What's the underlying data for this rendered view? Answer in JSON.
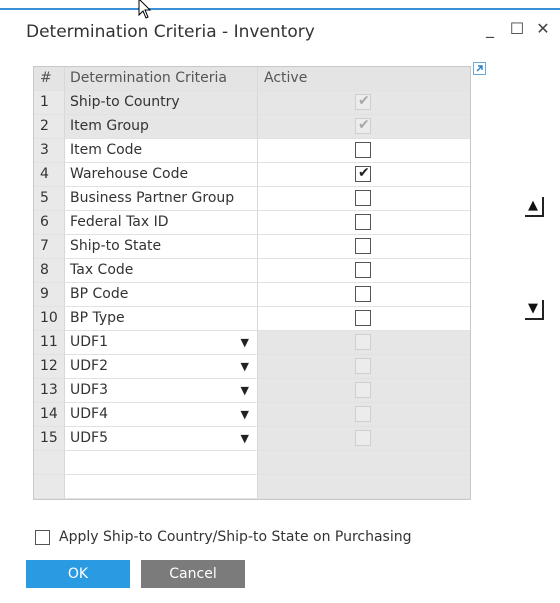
{
  "window": {
    "title": "Determination Criteria - Inventory",
    "minimize": "_",
    "maximize": "☐",
    "close": "✕"
  },
  "table": {
    "headers": [
      "#",
      "Determination Criteria",
      "Active"
    ],
    "rows": [
      {
        "num": "1",
        "criteria": "Ship-to Country",
        "active": true,
        "enabled": false,
        "dropdown": false,
        "gray": true
      },
      {
        "num": "2",
        "criteria": "Item Group",
        "active": true,
        "enabled": false,
        "dropdown": false,
        "gray": true
      },
      {
        "num": "3",
        "criteria": "Item Code",
        "active": false,
        "enabled": true,
        "dropdown": false,
        "gray": false
      },
      {
        "num": "4",
        "criteria": "Warehouse Code",
        "active": true,
        "enabled": true,
        "dropdown": false,
        "gray": false
      },
      {
        "num": "5",
        "criteria": "Business Partner Group",
        "active": false,
        "enabled": true,
        "dropdown": false,
        "gray": false
      },
      {
        "num": "6",
        "criteria": "Federal Tax ID",
        "active": false,
        "enabled": true,
        "dropdown": false,
        "gray": false
      },
      {
        "num": "7",
        "criteria": "Ship-to State",
        "active": false,
        "enabled": true,
        "dropdown": false,
        "gray": false
      },
      {
        "num": "8",
        "criteria": "Tax Code",
        "active": false,
        "enabled": true,
        "dropdown": false,
        "gray": false
      },
      {
        "num": "9",
        "criteria": "BP Code",
        "active": false,
        "enabled": true,
        "dropdown": false,
        "gray": false
      },
      {
        "num": "10",
        "criteria": "BP Type",
        "active": false,
        "enabled": true,
        "dropdown": false,
        "gray": false
      },
      {
        "num": "11",
        "criteria": "UDF1",
        "active": false,
        "enabled": false,
        "dropdown": true,
        "gray": false
      },
      {
        "num": "12",
        "criteria": "UDF2",
        "active": false,
        "enabled": false,
        "dropdown": true,
        "gray": false
      },
      {
        "num": "13",
        "criteria": "UDF3",
        "active": false,
        "enabled": false,
        "dropdown": true,
        "gray": false
      },
      {
        "num": "14",
        "criteria": "UDF4",
        "active": false,
        "enabled": false,
        "dropdown": true,
        "gray": false
      },
      {
        "num": "15",
        "criteria": "UDF5",
        "active": false,
        "enabled": false,
        "dropdown": true,
        "gray": false
      }
    ],
    "empty_rows": 2
  },
  "side_buttons": {
    "up_icon": "arrow-up-icon",
    "down_icon": "arrow-down-icon"
  },
  "apply_option": {
    "label": "Apply Ship-to Country/Ship-to State on Purchasing",
    "checked": false
  },
  "buttons": {
    "ok": "OK",
    "cancel": "Cancel"
  },
  "colors": {
    "ok_bg": "#2a9ae3",
    "cancel_bg": "#7b7b7b",
    "accent": "#3a8fd6"
  }
}
